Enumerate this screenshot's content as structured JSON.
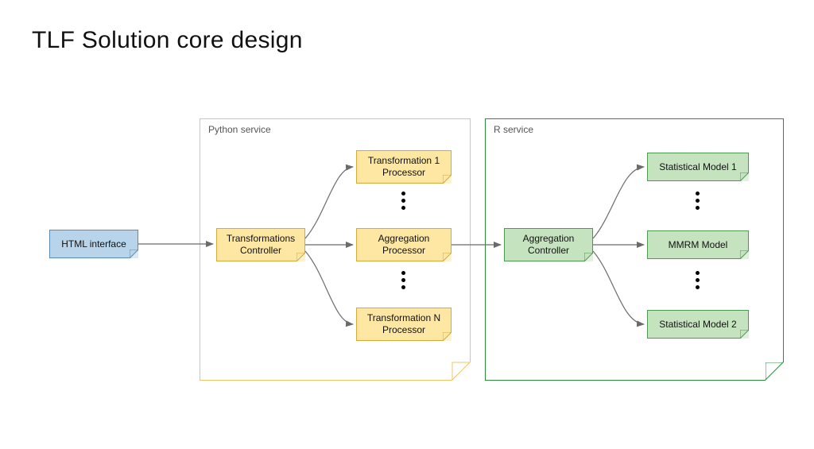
{
  "title": "TLF Solution core design",
  "groups": {
    "python": {
      "label": "Python service"
    },
    "r": {
      "label": "R service"
    }
  },
  "nodes": {
    "html_interface": "HTML interface",
    "transformations_ctrl": "Transformations\nController",
    "transformation_1_proc": "Transformation 1\nProcessor",
    "aggregation_proc": "Aggregation\nProcessor",
    "transformation_n_proc": "Transformation N\nProcessor",
    "aggregation_ctrl": "Aggregation\nController",
    "stat_model_1": "Statistical Model 1",
    "mmrm_model": "MMRM Model",
    "stat_model_2": "Statistical Model 2"
  },
  "colors": {
    "blue": "#b8d4ea",
    "yellow": "#fde7a3",
    "green": "#c6e3c0",
    "py_border": "#f0c36a",
    "r_border": "#2e8b3d",
    "arrow": "#6b6b6b"
  }
}
